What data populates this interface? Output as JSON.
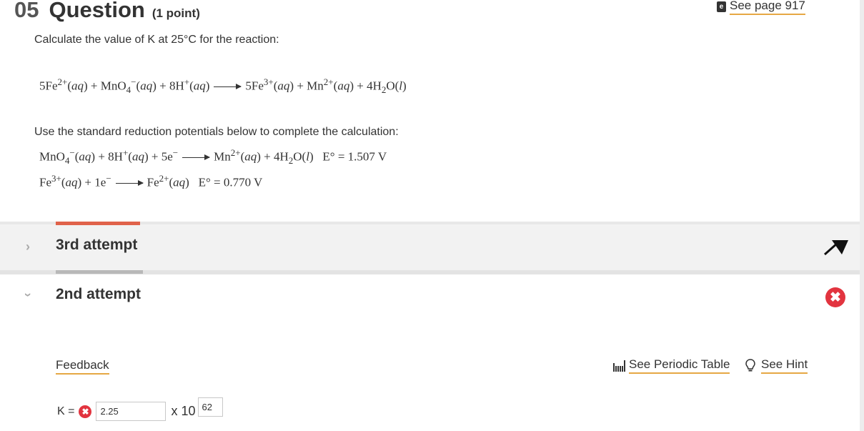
{
  "question": {
    "number": "05",
    "word": "Question",
    "points": "(1 point)",
    "see_page": "See page 917",
    "prompt": "Calculate the value of K at 25°C for the reaction:",
    "instructions": "Use the standard reduction potentials below to complete the calculation:",
    "reaction": {
      "coef_fe2": "5",
      "fe2_charge": "2+",
      "state_aq": "aq",
      "mno4_charge": "−",
      "mno4_sub": "4",
      "coef_h": "8",
      "h_charge": "+",
      "coef_fe3": "5",
      "fe3_charge": "3+",
      "mn_charge": "2+",
      "coef_h2o": "4",
      "h2o_sub": "2",
      "state_l": "l"
    },
    "half_reactions": [
      {
        "e_coef": "5",
        "e_value": "E° = 1.507 V"
      },
      {
        "e_coef": "1",
        "e_value": "E° = 0.770 V"
      }
    ]
  },
  "attempts": {
    "third": {
      "label": "3rd attempt"
    },
    "second": {
      "label": "2nd attempt"
    }
  },
  "links": {
    "feedback": "Feedback",
    "periodic_table": "See Periodic Table",
    "hint": "See Hint"
  },
  "answer": {
    "k_label": "K =",
    "mantissa": "2.25",
    "times_ten": "x 10",
    "exponent": "62"
  },
  "colors": {
    "accent_orange": "#e0624a",
    "error_red": "#e2343f",
    "underline": "#e6a844"
  }
}
